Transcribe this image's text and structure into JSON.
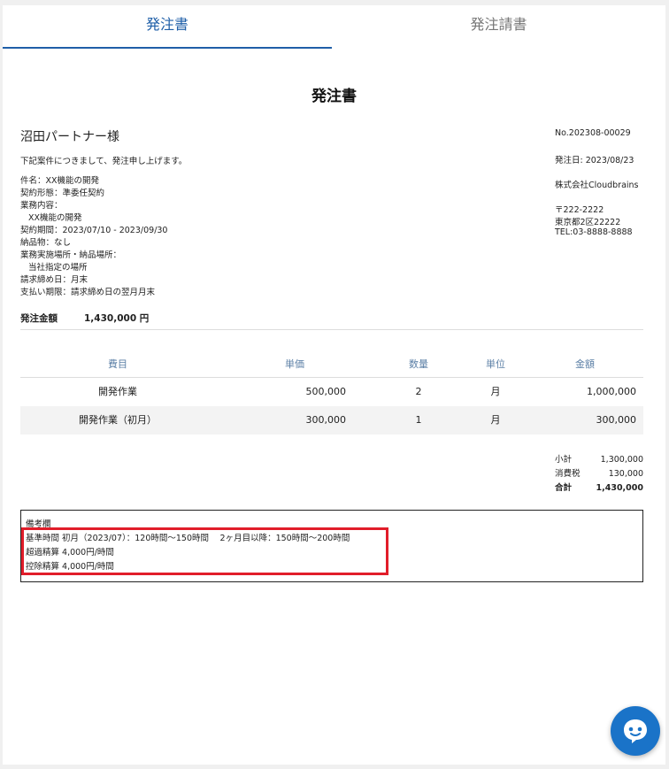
{
  "tabs": [
    {
      "label": "発注書",
      "active": true
    },
    {
      "label": "発注請書",
      "active": false
    }
  ],
  "document": {
    "title": "発注書",
    "recipient": "沼田パートナー様",
    "intro": "下記案件につきまして、発注申し上げます。",
    "details": [
      "件名：XX機能の開発",
      "契約形態：準委任契約",
      "業務内容：",
      "XX機能の開発",
      "契約期間：2023/07/10 - 2023/09/30",
      "納品物：なし",
      "業務実施場所・納品場所：",
      "当社指定の場所",
      "請求締め日：月末",
      "支払い期限：請求締め日の翌月月末"
    ],
    "number": "No.202308-00029",
    "issue_date": "発注日: 2023/08/23",
    "company": "株式会社Cloudbrains",
    "postal": "〒222-2222",
    "address": "東京都2区22222",
    "tel": "TEL:03-8888-8888",
    "total_label": "発注金額",
    "total_value": "1,430,000 円"
  },
  "items_table": {
    "headers": [
      "費目",
      "単価",
      "数量",
      "単位",
      "金額"
    ],
    "rows": [
      [
        "開発作業",
        "500,000",
        "2",
        "月",
        "1,000,000"
      ],
      [
        "開発作業（初月）",
        "300,000",
        "1",
        "月",
        "300,000"
      ]
    ]
  },
  "summary": {
    "subtotal_label": "小計",
    "subtotal": "1,300,000",
    "tax_label": "消費税",
    "tax": "130,000",
    "total_label": "合計",
    "total": "1,430,000"
  },
  "notes": {
    "title": "備考欄",
    "lines": [
      "基準時間 初月（2023/07）：120時間〜150時間　 2ヶ月目以降：150時間〜200時間",
      "超過精算 4,000円/時間",
      "控除精算 4,000円/時間"
    ]
  },
  "colors": {
    "accent": "#1f5fa8",
    "highlight": "#e11d2a",
    "chat_button": "#1a73c8"
  },
  "icons": {
    "chat": "chat-bubble-icon"
  }
}
